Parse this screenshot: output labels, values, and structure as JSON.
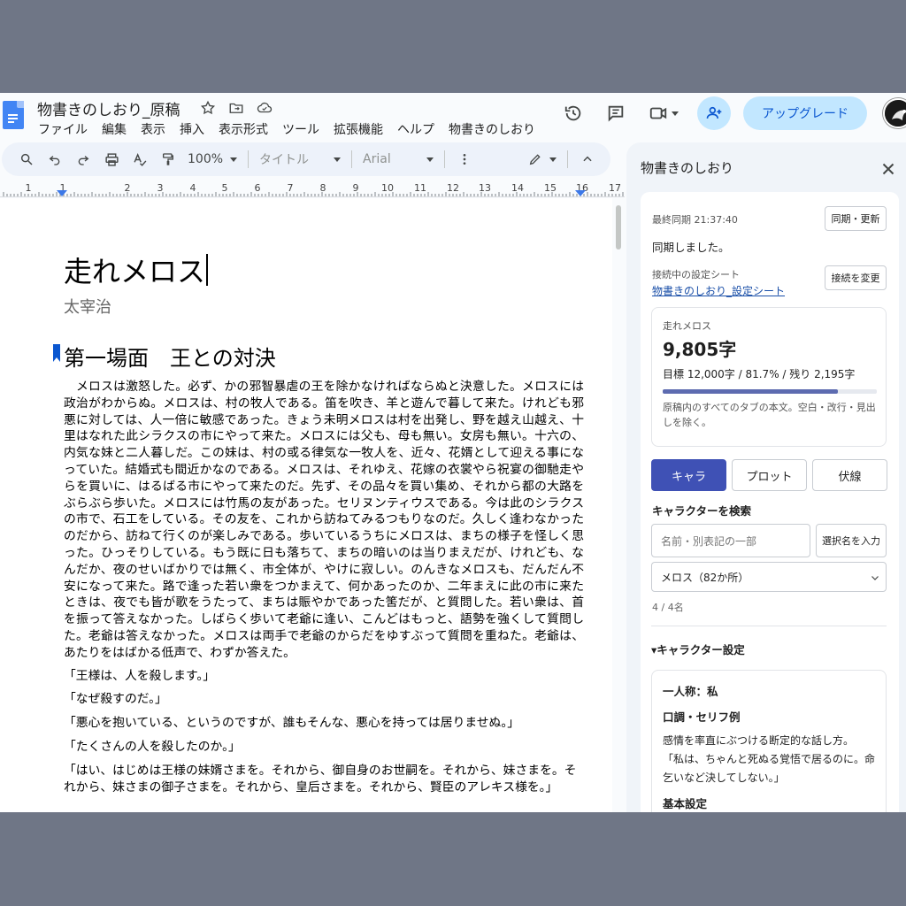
{
  "header": {
    "doc_title": "物書きのしおり_原稿",
    "menu": [
      "ファイル",
      "編集",
      "表示",
      "挿入",
      "表示形式",
      "ツール",
      "拡張機能",
      "ヘルプ",
      "物書きのしおり"
    ],
    "upgrade_label": "アップグレード"
  },
  "toolbar": {
    "zoom": "100%",
    "style": "タイトル",
    "font": "Arial"
  },
  "ruler": {
    "numbers": [
      "1",
      "1",
      "2",
      "3",
      "4",
      "5",
      "6",
      "7",
      "8",
      "9",
      "10",
      "11",
      "12",
      "13",
      "14",
      "15",
      "16",
      "17"
    ]
  },
  "document": {
    "title": "走れメロス",
    "author": "太宰治",
    "heading": "第一場面　王との対決",
    "paragraph": "　メロスは激怒した。必ず、かの邪智暴虐の王を除かなければならぬと決意した。メロスには政治がわからぬ。メロスは、村の牧人である。笛を吹き、羊と遊んで暮して来た。けれども邪悪に対しては、人一倍に敏感であった。きょう未明メロスは村を出発し、野を越え山越え、十里はなれた此シラクスの市にやって来た。メロスには父も、母も無い。女房も無い。十六の、内気な妹と二人暮しだ。この妹は、村の或る律気な一牧人を、近々、花婿として迎える事になっていた。結婚式も間近かなのである。メロスは、それゆえ、花嫁の衣裳やら祝宴の御馳走やらを買いに、はるばる市にやって来たのだ。先ず、その品々を買い集め、それから都の大路をぶらぶら歩いた。メロスには竹馬の友があった。セリヌンティウスである。今は此のシラクスの市で、石工をしている。その友を、これから訪ねてみるつもりなのだ。久しく逢わなかったのだから、訪ねて行くのが楽しみである。歩いているうちにメロスは、まちの様子を怪しく思った。ひっそりしている。もう既に日も落ちて、まちの暗いのは当りまえだが、けれども、なんだか、夜のせいばかりでは無く、市全体が、やけに寂しい。のんきなメロスも、だんだん不安になって来た。路で逢った若い衆をつかまえて、何かあったのか、二年まえに此の市に来たときは、夜でも皆が歌をうたって、まちは賑やかであった筈だが、と質問した。若い衆は、首を振って答えなかった。しばらく歩いて老爺に逢い、こんどはもっと、語勢を強くして質問した。老爺は答えなかった。メロスは両手で老爺のからだをゆすぶって質問を重ねた。老爺は、あたりをはばかる低声で、わずか答えた。",
    "dialogue": [
      "「王様は、人を殺します。」",
      "「なぜ殺すのだ。」",
      "「悪心を抱いている、というのですが、誰もそんな、悪心を持っては居りませぬ。」",
      "「たくさんの人を殺したのか。」",
      "「はい、はじめは王様の妹婿さまを。それから、御自身のお世嗣を。それから、妹さまを。それから、妹さまの御子さまを。それから、皇后さまを。それから、賢臣のアレキス様を。」"
    ]
  },
  "panel": {
    "title": "物書きのしおり",
    "last_sync": "最終同期 21:37:40",
    "sync_button": "同期・更新",
    "sync_status": "同期しました。",
    "connected_label": "接続中の設定シート",
    "connected_sheet": "物書きのしおり_設定シート",
    "change_button": "接続を変更",
    "stat_title": "走れメロス",
    "char_count": "9,805字",
    "goal_text": "目標 12,000字 / 81.7% / 残り 2,195字",
    "progress": 0.817,
    "note": "原稿内のすべてのタブの本文。空白・改行・見出しを除く。",
    "tabs": [
      "キャラ",
      "プロット",
      "伏線"
    ],
    "search_label": "キャラクターを検索",
    "search_placeholder": "名前・別表記の一部",
    "insert_button": "選択名を入力",
    "select_value": "メロス（82か所）",
    "count": "4 / 4名",
    "settings_heading": "▾キャラクター設定",
    "first_person": "一人称：私",
    "speech_heading": "口調・セリフ例",
    "speech_desc": "感情を率直にぶつける断定的な話し方。",
    "speech_example": "「私は、ちゃんと死ぬる覚悟で居るのに。命乞いなど決してしない。」",
    "basic_heading": "基本設定"
  }
}
